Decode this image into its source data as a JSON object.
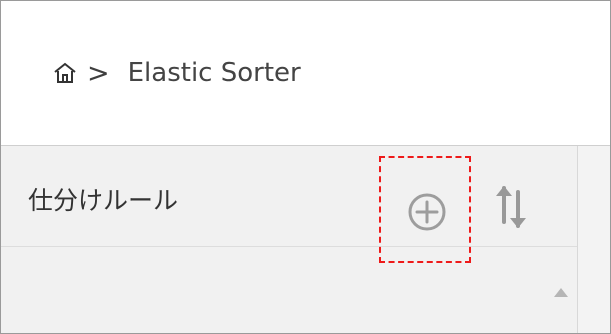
{
  "header": {
    "separator": ">",
    "title": "Elastic Sorter",
    "home_icon": "home-icon"
  },
  "rules_panel": {
    "title": "仕分けルール",
    "add_icon": "plus-circle-icon",
    "sort_icon": "sort-icon",
    "scroll_icon": "triangle-up-icon"
  },
  "colors": {
    "highlight": "#ee1a1a",
    "icon_gray": "#9d9d9d",
    "text": "#333333"
  }
}
